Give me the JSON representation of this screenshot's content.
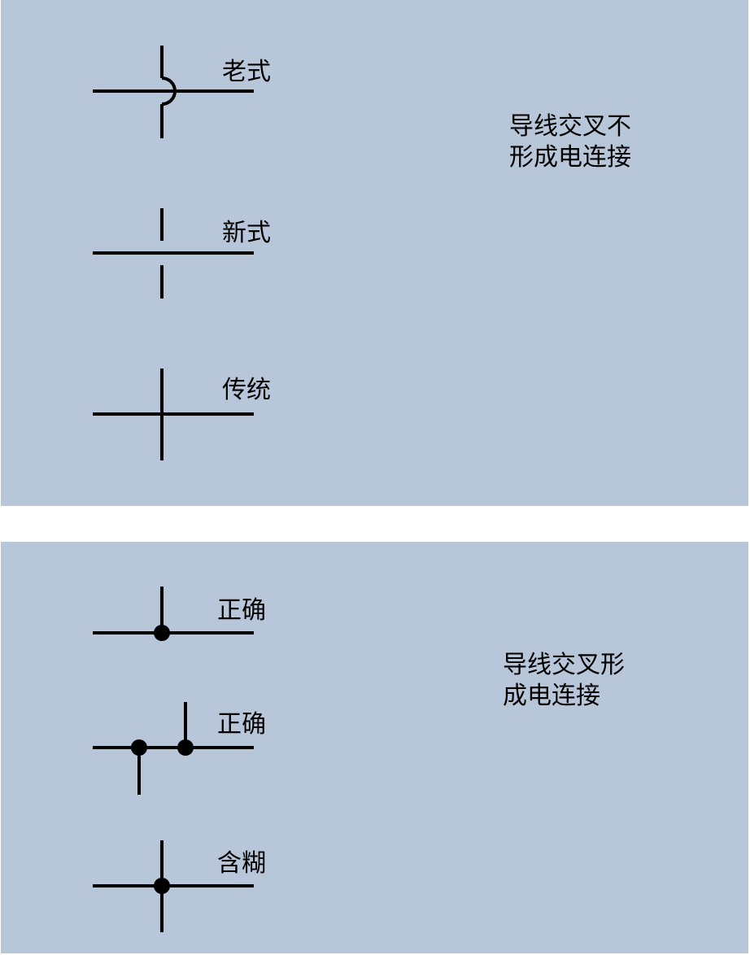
{
  "panels": {
    "no_connection": {
      "description_lines": [
        "导线交叉不",
        "形成电连接"
      ],
      "symbols": [
        {
          "id": "hop",
          "label": "老式"
        },
        {
          "id": "gap",
          "label": "新式"
        },
        {
          "id": "plain-cross",
          "label": "传统"
        }
      ]
    },
    "connection": {
      "description_lines": [
        "导线交叉形",
        "成电连接"
      ],
      "symbols": [
        {
          "id": "tee-dot",
          "label": "正确"
        },
        {
          "id": "double-tee-dot",
          "label": "正确"
        },
        {
          "id": "cross-dot",
          "label": "含糊"
        }
      ]
    }
  },
  "colors": {
    "panel_background": "#b8c6da",
    "wire": "#000000"
  }
}
